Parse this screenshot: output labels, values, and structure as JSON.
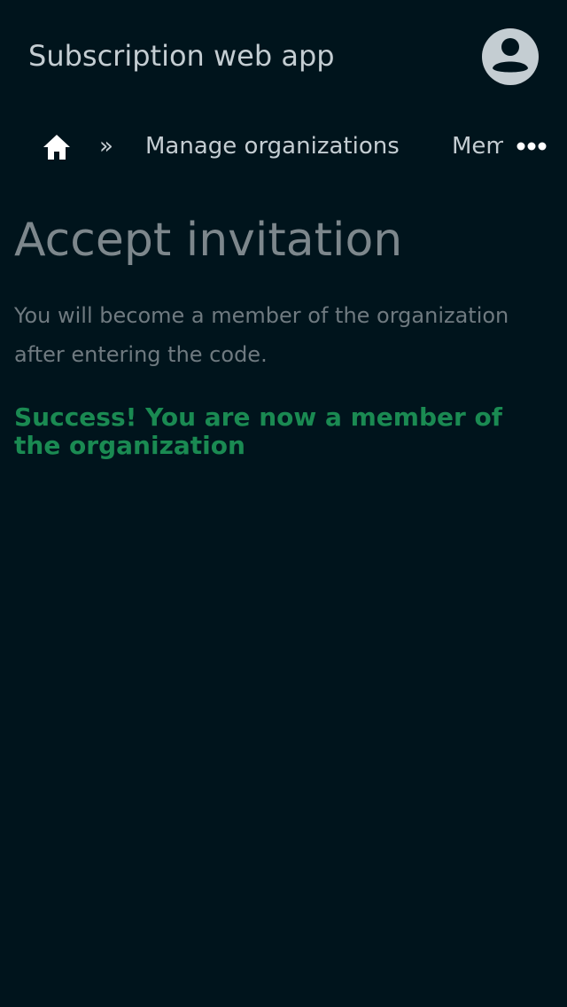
{
  "header": {
    "app_title": "Subscription web app",
    "avatar_icon": "account-circle-icon"
  },
  "breadcrumb": {
    "home_icon": "home-icon",
    "separator": "»",
    "items": [
      {
        "label": "Manage organizations"
      },
      {
        "label": "Members"
      }
    ],
    "more_icon": "more-horizontal-icon"
  },
  "main": {
    "title": "Accept invitation",
    "description": "You will become a member of the organization after entering the code.",
    "success_message": "Success! You are now a member of the organization"
  },
  "colors": {
    "background": "#00141c",
    "success": "#1a8a52",
    "heading": "#7d878c"
  }
}
